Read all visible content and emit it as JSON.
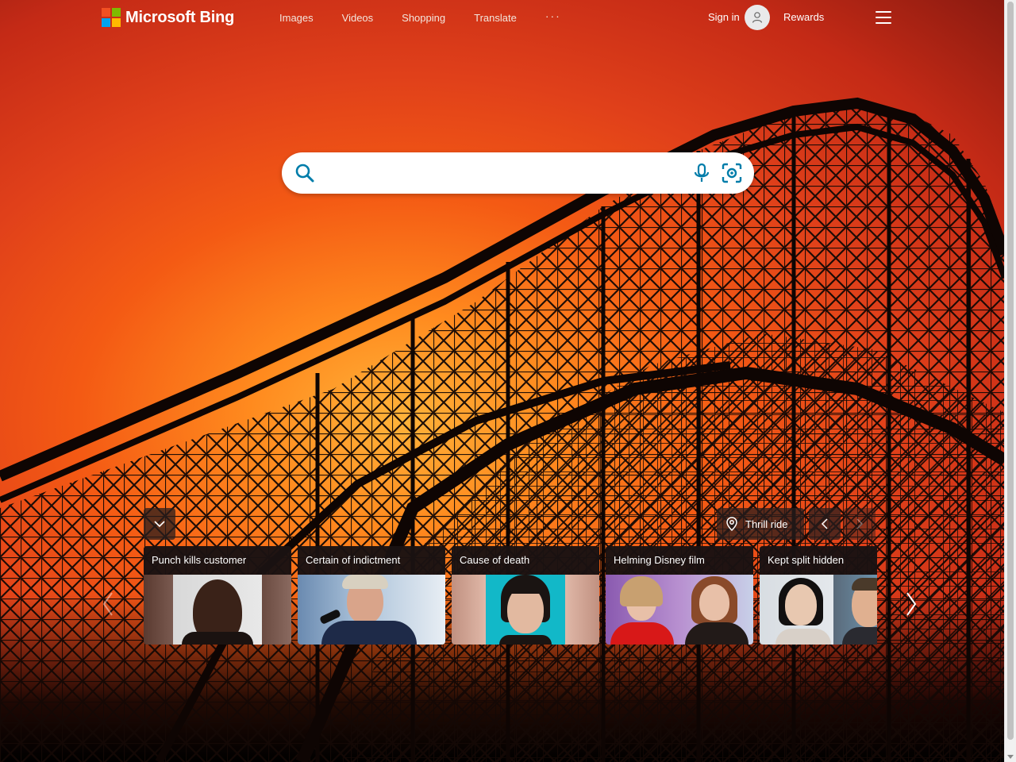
{
  "header": {
    "brand": "Microsoft Bing",
    "nav": [
      "Images",
      "Videos",
      "Shopping",
      "Translate"
    ],
    "more_label": "···",
    "sign_in": "Sign in",
    "rewards": "Rewards"
  },
  "search": {
    "value": "",
    "placeholder": ""
  },
  "location": {
    "label": "Thrill ride"
  },
  "cards": [
    {
      "title": "Punch kills customer"
    },
    {
      "title": "Certain of indictment"
    },
    {
      "title": "Cause of death"
    },
    {
      "title": "Helming Disney film"
    },
    {
      "title": "Kept split hidden"
    }
  ],
  "icons": {
    "logo": "microsoft-logo",
    "avatar": "user-avatar-icon",
    "menu": "hamburger-menu-icon",
    "search": "search-icon",
    "mic": "microphone-icon",
    "visual_search": "visual-search-icon",
    "collapse": "chevron-down-icon",
    "pin": "location-pin-icon",
    "prev": "chevron-left-icon",
    "next": "chevron-right-icon"
  },
  "colors": {
    "accent": "#174ae4",
    "search_icon": "#007daa",
    "logo_red": "#f25022",
    "logo_green": "#7fba00",
    "logo_blue": "#00a4ef",
    "logo_yellow": "#ffb900"
  }
}
